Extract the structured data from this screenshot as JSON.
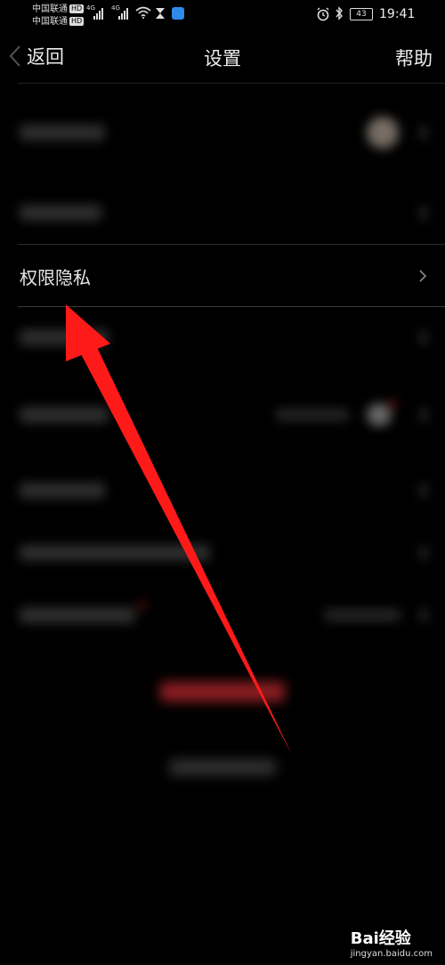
{
  "status_bar": {
    "carrier_1": "中国联通",
    "carrier_2": "中国联通",
    "hd_badge": "HD",
    "network_1": "4G",
    "network_2": "4G",
    "battery": "43",
    "time": "19:41"
  },
  "nav": {
    "back_label": "返回",
    "title": "设置",
    "help_label": "帮助"
  },
  "rows": {
    "highlight_label": "权限隐私"
  },
  "watermark": {
    "brand": "Bai经验",
    "url": "jingyan.baidu.com"
  },
  "colors": {
    "background": "#000000",
    "arrow": "#ff1a1a",
    "logout_blur": "#a8242a"
  }
}
